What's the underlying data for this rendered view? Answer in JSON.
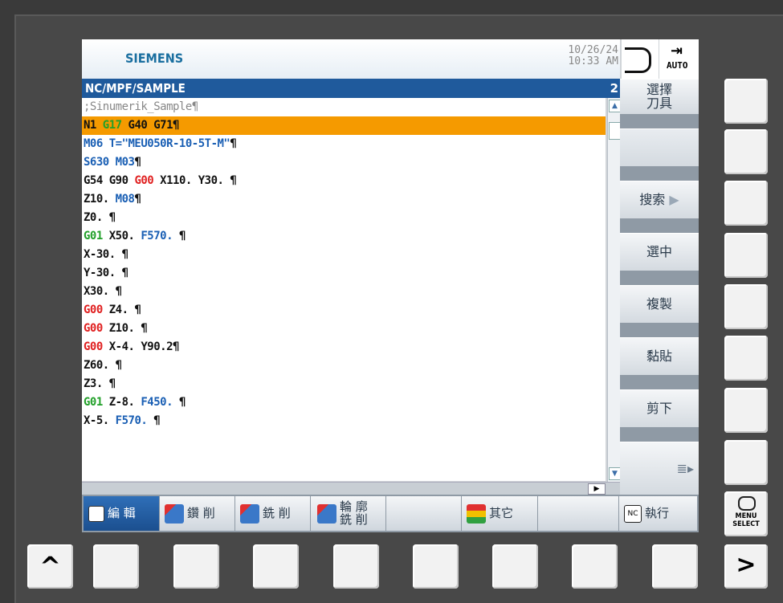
{
  "header": {
    "brand": "SIEMENS",
    "date": "10/26/24",
    "time": "10:33 AM",
    "mode": "AUTO"
  },
  "path": {
    "title": "NC/MPF/SAMPLE",
    "channel": "2"
  },
  "program_lines": [
    [
      {
        "t": ";Sinumerik_Sample¶",
        "c": "comment"
      }
    ],
    [
      {
        "t": "N1 ",
        "c": "p"
      },
      {
        "t": "G17",
        "c": "g"
      },
      {
        "t": " G40 G71¶",
        "c": "p"
      }
    ],
    [
      {
        "t": "M06 T=\"MEU050R-10-5T-M\"",
        "c": "b"
      },
      {
        "t": "¶",
        "c": "p"
      }
    ],
    [
      {
        "t": "S630 M03",
        "c": "b"
      },
      {
        "t": "¶",
        "c": "p"
      }
    ],
    [
      {
        "t": "G54 G90 ",
        "c": "p"
      },
      {
        "t": "G00",
        "c": "r"
      },
      {
        "t": " X110. Y30. ¶",
        "c": "p"
      }
    ],
    [
      {
        "t": "Z10. ",
        "c": "p"
      },
      {
        "t": "M08",
        "c": "b"
      },
      {
        "t": "¶",
        "c": "p"
      }
    ],
    [
      {
        "t": "Z0. ¶",
        "c": "p"
      }
    ],
    [
      {
        "t": "G01",
        "c": "g"
      },
      {
        "t": " X50. ",
        "c": "p"
      },
      {
        "t": "F570.",
        "c": "b"
      },
      {
        "t": " ¶",
        "c": "p"
      }
    ],
    [
      {
        "t": "X-30. ¶",
        "c": "p"
      }
    ],
    [
      {
        "t": "Y-30. ¶",
        "c": "p"
      }
    ],
    [
      {
        "t": "X30. ¶",
        "c": "p"
      }
    ],
    [
      {
        "t": "G00",
        "c": "r"
      },
      {
        "t": " Z4. ¶",
        "c": "p"
      }
    ],
    [
      {
        "t": "G00",
        "c": "r"
      },
      {
        "t": " Z10. ¶",
        "c": "p"
      }
    ],
    [
      {
        "t": "G00",
        "c": "r"
      },
      {
        "t": " X-4. Y90.2¶",
        "c": "p"
      }
    ],
    [
      {
        "t": "Z60. ¶",
        "c": "p"
      }
    ],
    [
      {
        "t": "Z3. ¶",
        "c": "p"
      }
    ],
    [
      {
        "t": "G01",
        "c": "g"
      },
      {
        "t": " Z-8. ",
        "c": "p"
      },
      {
        "t": "F450.",
        "c": "b"
      },
      {
        "t": " ¶",
        "c": "p"
      }
    ],
    [
      {
        "t": "X-5. ",
        "c": "p"
      },
      {
        "t": "F570.",
        "c": "b"
      },
      {
        "t": " ¶",
        "c": "p"
      }
    ]
  ],
  "selected_line_index": 1,
  "vertical_softkeys": {
    "select_tool": "選擇\n刀具",
    "search": "搜索",
    "mark": "選中",
    "copy": "複製",
    "paste": "黏貼",
    "cut": "剪下"
  },
  "horizontal_softkeys": {
    "edit": "編 輯",
    "drilling": "鑽 削",
    "milling": "銑 削",
    "contour_milling": "輪 廓\n銑 削",
    "various": "其它",
    "execute": "執行"
  },
  "hardware_keys": {
    "recall": "^",
    "etc": ">",
    "menu_select": "MENU\nSELECT"
  }
}
